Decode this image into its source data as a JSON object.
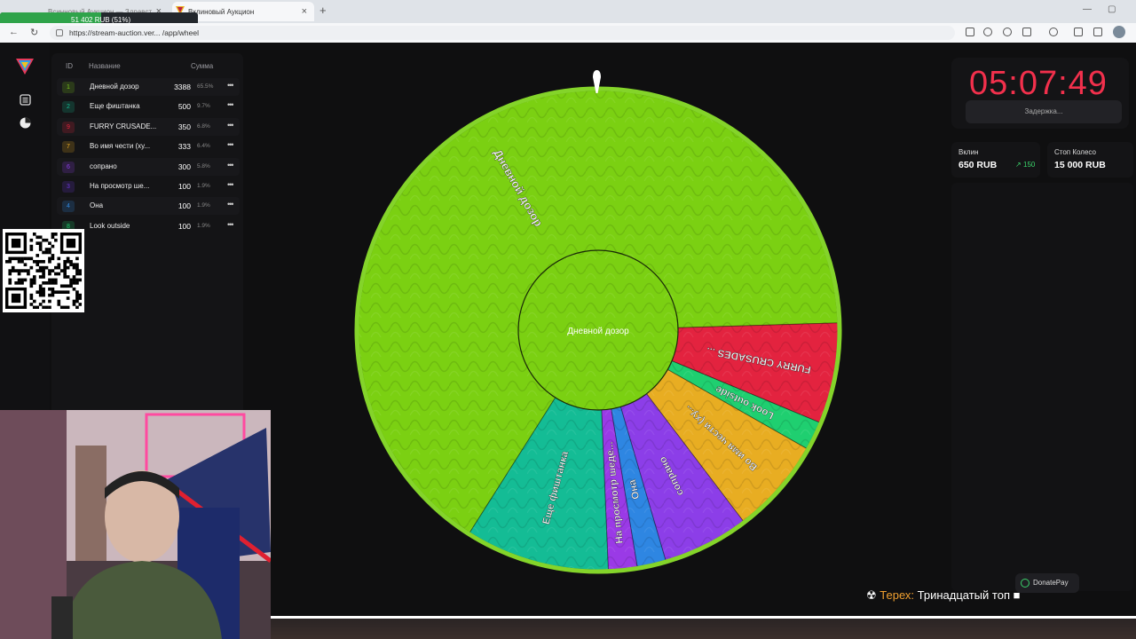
{
  "browser": {
    "inactive_tab_label": "Всинновый Аукцион — Здравст...",
    "active_tab_label": "Вклиновый Аукцион",
    "new_tab": "+",
    "url": "https://stream-auction.ver... /app/wheel",
    "progress_text": "51 402 RUB (51%)",
    "progress_fraction": 0.51
  },
  "lots": {
    "headers": {
      "id": "ID",
      "name": "Название",
      "sum": "Сумма"
    },
    "rows": [
      {
        "id": "1",
        "name": "Дневной дозор",
        "sum": "3388",
        "pct": "65.5%",
        "color": "#7ac41a"
      },
      {
        "id": "2",
        "name": "Еще фиштанка",
        "sum": "500",
        "pct": "9.7%",
        "color": "#14b891"
      },
      {
        "id": "9",
        "name": "FURRY CRUSADE...",
        "sum": "350",
        "pct": "6.8%",
        "color": "#e0243c"
      },
      {
        "id": "7",
        "name": "Во имя чести (ху...",
        "sum": "333",
        "pct": "6.4%",
        "color": "#e8a823"
      },
      {
        "id": "6",
        "name": "сопрано",
        "sum": "300",
        "pct": "5.8%",
        "color": "#8b3ee6"
      },
      {
        "id": "3",
        "name": "На просмотр ше...",
        "sum": "100",
        "pct": "1.9%",
        "color": "#6a35d8"
      },
      {
        "id": "4",
        "name": "Она",
        "sum": "100",
        "pct": "1.9%",
        "color": "#2f88e0"
      },
      {
        "id": "8",
        "name": "Look outside",
        "sum": "100",
        "pct": "1.9%",
        "color": "#1ecf6e"
      }
    ],
    "more_icon": "more-dots-icon"
  },
  "wheel": {
    "center_label": "Дневной дозор",
    "segments": [
      {
        "label": "Дневной дозор",
        "value": 3388,
        "color": "#7bd012"
      },
      {
        "label": "FURRY CRUSADES ...",
        "value": 350,
        "color": "#e3233f"
      },
      {
        "label": "Look outside",
        "value": 100,
        "color": "#1fcf70"
      },
      {
        "label": "Во имя чести (ху...",
        "value": 333,
        "color": "#e8ad22"
      },
      {
        "label": "сопрано",
        "value": 300,
        "color": "#8c3ee8"
      },
      {
        "label": "Она",
        "value": 100,
        "color": "#2e86e2"
      },
      {
        "label": "На просмотр шеде...",
        "value": 100,
        "color": "#9a3ae6"
      },
      {
        "label": "Еще фиштанка",
        "value": 500,
        "color": "#14bc95"
      }
    ]
  },
  "timer": {
    "value": "05:07:49",
    "delay_label": "Задержка..."
  },
  "stats": {
    "contribution": {
      "label": "Вклин",
      "value": "650 RUB",
      "delta": "150"
    },
    "stop": {
      "label": "Стоп Колесо",
      "value": "15 000 RUB"
    }
  },
  "donate_label": "DonatePay",
  "chat": {
    "user": "Терех:",
    "message": "Тринадцатый топ"
  }
}
